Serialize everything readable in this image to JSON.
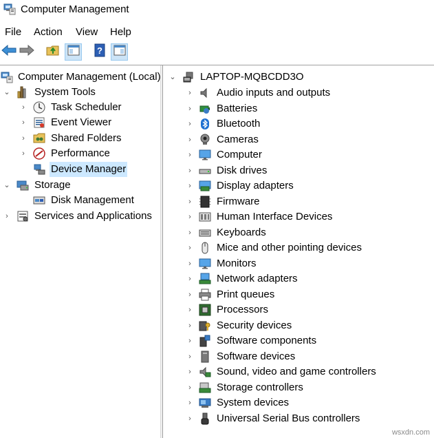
{
  "window": {
    "title": "Computer Management"
  },
  "menu": [
    "File",
    "Action",
    "View",
    "Help"
  ],
  "toolbar": [
    {
      "icon": "back-arrow-icon"
    },
    {
      "icon": "forward-arrow-icon"
    },
    {
      "icon": "up-folder-icon"
    },
    {
      "icon": "show-hide-console-tree-icon"
    },
    {
      "icon": "help-icon"
    },
    {
      "icon": "show-hide-action-pane-icon"
    }
  ],
  "left_tree": [
    {
      "label": "Computer Management (Local)",
      "icon": "computer-management-icon",
      "expander": "none",
      "level": 0
    },
    {
      "label": "System Tools",
      "icon": "system-tools-icon",
      "expander": "expanded",
      "level": 1
    },
    {
      "label": "Task Scheduler",
      "icon": "clock-icon",
      "expander": "collapsed",
      "level": 2
    },
    {
      "label": "Event Viewer",
      "icon": "event-viewer-icon",
      "expander": "collapsed",
      "level": 2
    },
    {
      "label": "Shared Folders",
      "icon": "shared-folder-icon",
      "expander": "collapsed",
      "level": 2
    },
    {
      "label": "Performance",
      "icon": "performance-icon",
      "expander": "collapsed",
      "level": 2
    },
    {
      "label": "Device Manager",
      "icon": "device-manager-icon",
      "expander": "none",
      "level": 2,
      "selected": true
    },
    {
      "label": "Storage",
      "icon": "storage-icon",
      "expander": "expanded",
      "level": 1
    },
    {
      "label": "Disk Management",
      "icon": "disk-management-icon",
      "expander": "none",
      "level": 2
    },
    {
      "label": "Services and Applications",
      "icon": "services-icon",
      "expander": "collapsed",
      "level": 1
    }
  ],
  "right_tree": {
    "root": {
      "label": "LAPTOP-MQBCDD3O",
      "icon": "laptop-icon"
    },
    "categories": [
      {
        "label": "Audio inputs and outputs",
        "icon": "speaker-icon"
      },
      {
        "label": "Batteries",
        "icon": "battery-icon"
      },
      {
        "label": "Bluetooth",
        "icon": "bluetooth-icon"
      },
      {
        "label": "Cameras",
        "icon": "camera-icon"
      },
      {
        "label": "Computer",
        "icon": "monitor-icon"
      },
      {
        "label": "Disk drives",
        "icon": "disk-drive-icon"
      },
      {
        "label": "Display adapters",
        "icon": "display-adapter-icon"
      },
      {
        "label": "Firmware",
        "icon": "firmware-icon"
      },
      {
        "label": "Human Interface Devices",
        "icon": "hid-icon"
      },
      {
        "label": "Keyboards",
        "icon": "keyboard-icon"
      },
      {
        "label": "Mice and other pointing devices",
        "icon": "mouse-icon"
      },
      {
        "label": "Monitors",
        "icon": "monitor-icon"
      },
      {
        "label": "Network adapters",
        "icon": "network-adapter-icon"
      },
      {
        "label": "Print queues",
        "icon": "printer-icon"
      },
      {
        "label": "Processors",
        "icon": "processor-icon"
      },
      {
        "label": "Security devices",
        "icon": "security-device-icon"
      },
      {
        "label": "Software components",
        "icon": "software-component-icon"
      },
      {
        "label": "Software devices",
        "icon": "software-device-icon"
      },
      {
        "label": "Sound, video and game controllers",
        "icon": "sound-controller-icon"
      },
      {
        "label": "Storage controllers",
        "icon": "storage-controller-icon"
      },
      {
        "label": "System devices",
        "icon": "system-device-icon"
      },
      {
        "label": "Universal Serial Bus controllers",
        "icon": "usb-icon"
      }
    ]
  },
  "watermark": "wsxdn.com"
}
